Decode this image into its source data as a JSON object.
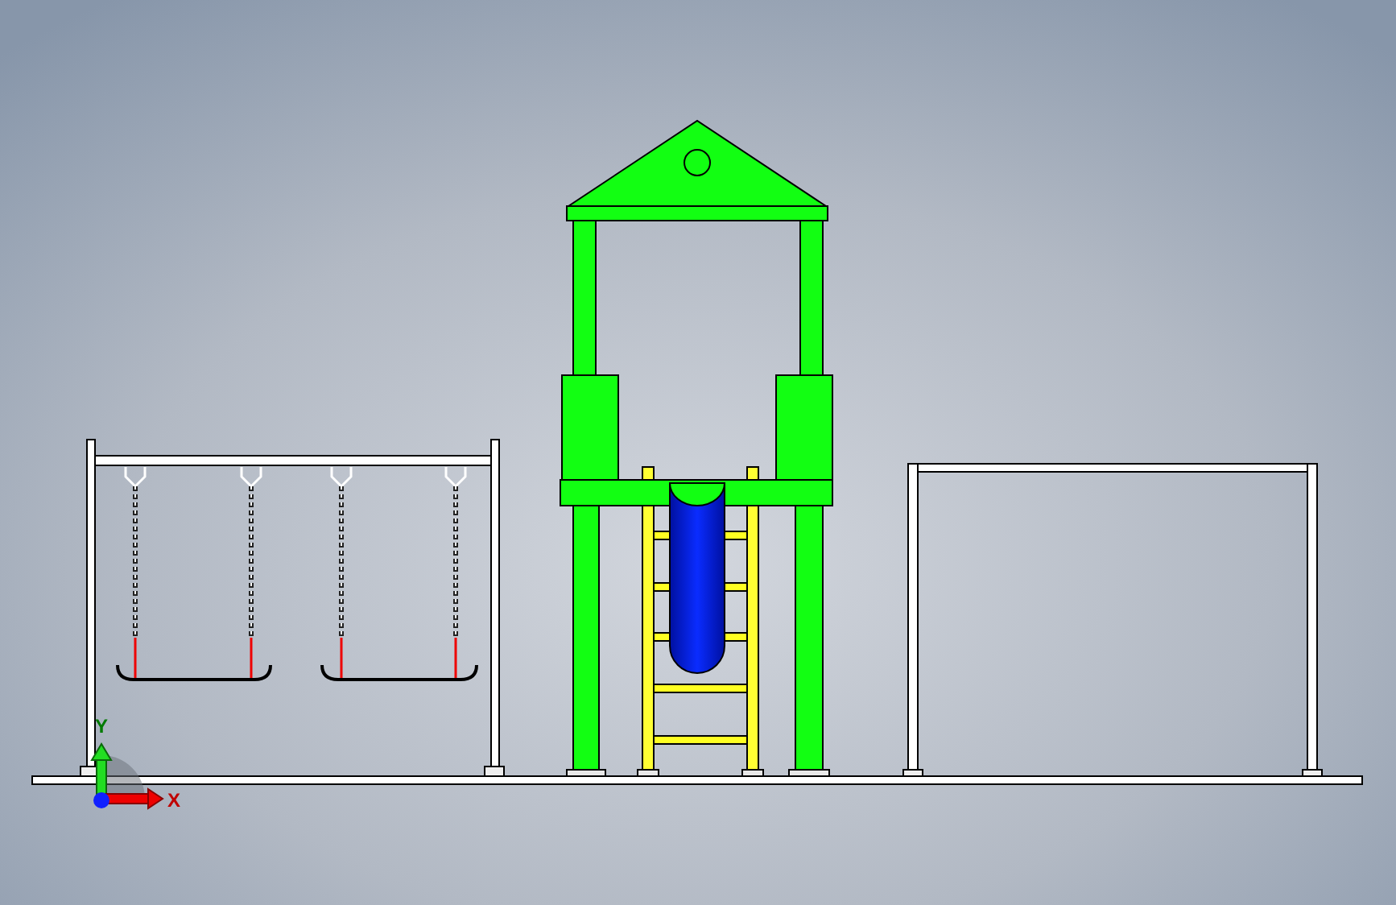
{
  "axis_triad": {
    "x_label": "X",
    "y_label": "Y"
  }
}
